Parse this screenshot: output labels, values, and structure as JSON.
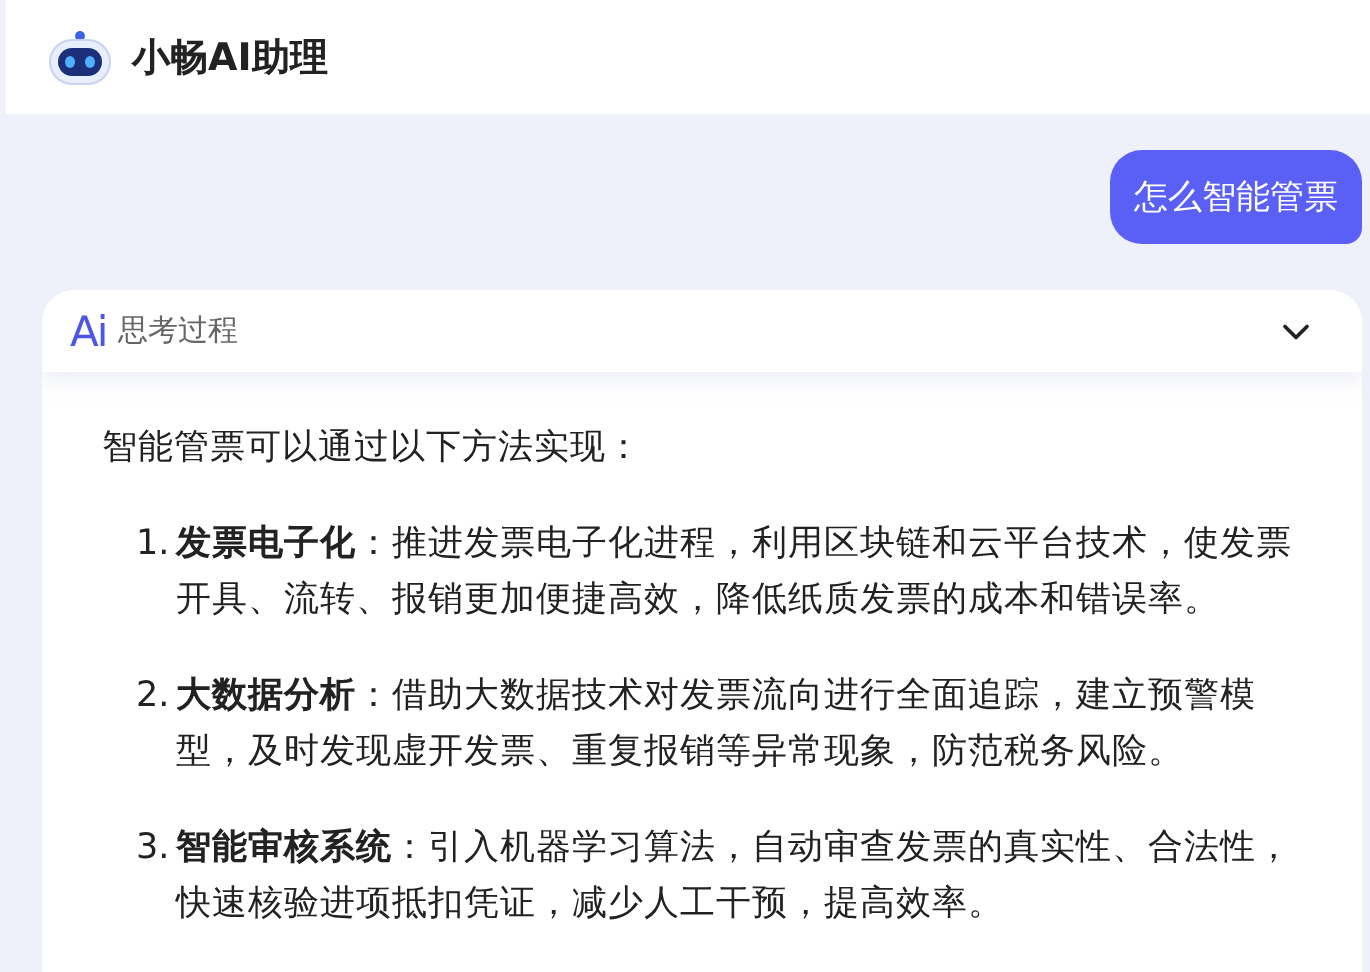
{
  "header": {
    "title": "小畅AI助理"
  },
  "user_message": {
    "text": "怎么智能管票"
  },
  "thinking": {
    "badge": "Ai",
    "label": "思考过程"
  },
  "answer": {
    "intro": "智能管票可以通过以下方法实现：",
    "items": [
      {
        "number": "1.",
        "title": "发票电子化",
        "text": "：推进发票电子化进程，利用区块链和云平台技术，使发票开具、流转、报销更加便捷高效，降低纸质发票的成本和错误率。"
      },
      {
        "number": "2.",
        "title": "大数据分析",
        "text": "：借助大数据技术对发票流向进行全面追踪，建立预警模型，及时发现虚开发票、重复报销等异常现象，防范税务风险。"
      },
      {
        "number": "3.",
        "title": "智能审核系统",
        "text": "：引入机器学习算法，自动审查发票的真实性、合法性，快速核验进项抵扣凭证，减少人工干预，提高效率。"
      }
    ]
  }
}
